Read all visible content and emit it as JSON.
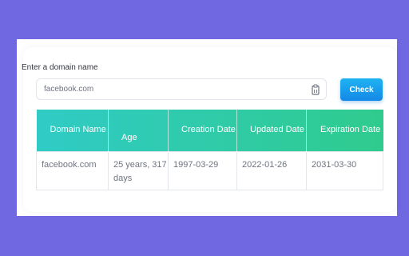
{
  "form": {
    "label": "Enter a domain name",
    "domain_value": "facebook.com",
    "check_label": "Check"
  },
  "table": {
    "headers": [
      "Domain Name",
      "Age",
      "Creation Date",
      "Updated Date",
      "Expiration Date"
    ],
    "rows": [
      [
        "facebook.com",
        "25 years, 317 days",
        "1997-03-29",
        "2022-01-26",
        "2031-03-30"
      ]
    ]
  },
  "colors": {
    "background": "#7068e0",
    "button_gradient": [
      "#1fb3f2",
      "#1488e6"
    ],
    "header_gradient": [
      "#30cbc5",
      "#2fcb8d"
    ]
  }
}
